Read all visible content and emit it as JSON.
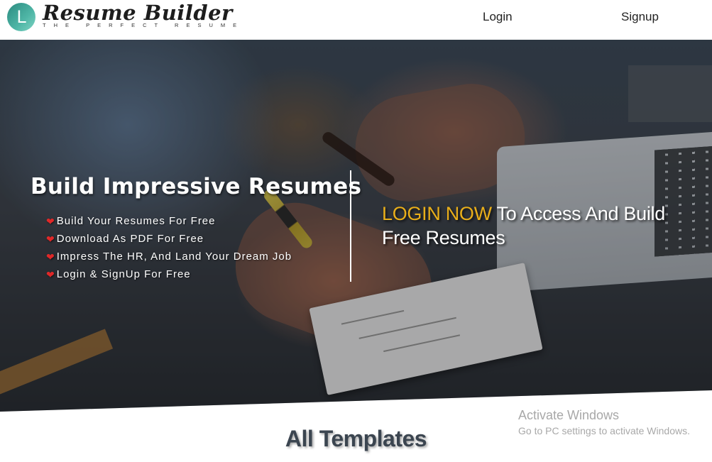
{
  "header": {
    "logo_letter": "L",
    "brand_name": "Resume Builder",
    "tagline": "THE PERFECT RESUME",
    "nav": [
      {
        "label": "Login"
      },
      {
        "label": "Signup"
      }
    ]
  },
  "hero": {
    "title": "Build Impressive Resumes",
    "features": [
      "Build Your Resumes For Free",
      "Download As PDF For Free",
      "Impress The HR, And Land Your Dream Job",
      "Login & SignUp For Free"
    ],
    "cta_highlight": "LOGIN NOW",
    "cta_rest": " To Access And Build Free Resumes",
    "colors": {
      "highlight": "#e8ae1a",
      "heart": "#e02828",
      "logo_teal": "#3fa596"
    }
  },
  "section": {
    "title": "All Templates"
  },
  "watermark": {
    "title": "Activate Windows",
    "subtitle": "Go to PC settings to activate Windows."
  },
  "icons": [
    "logo-icon",
    "heart-icon"
  ]
}
